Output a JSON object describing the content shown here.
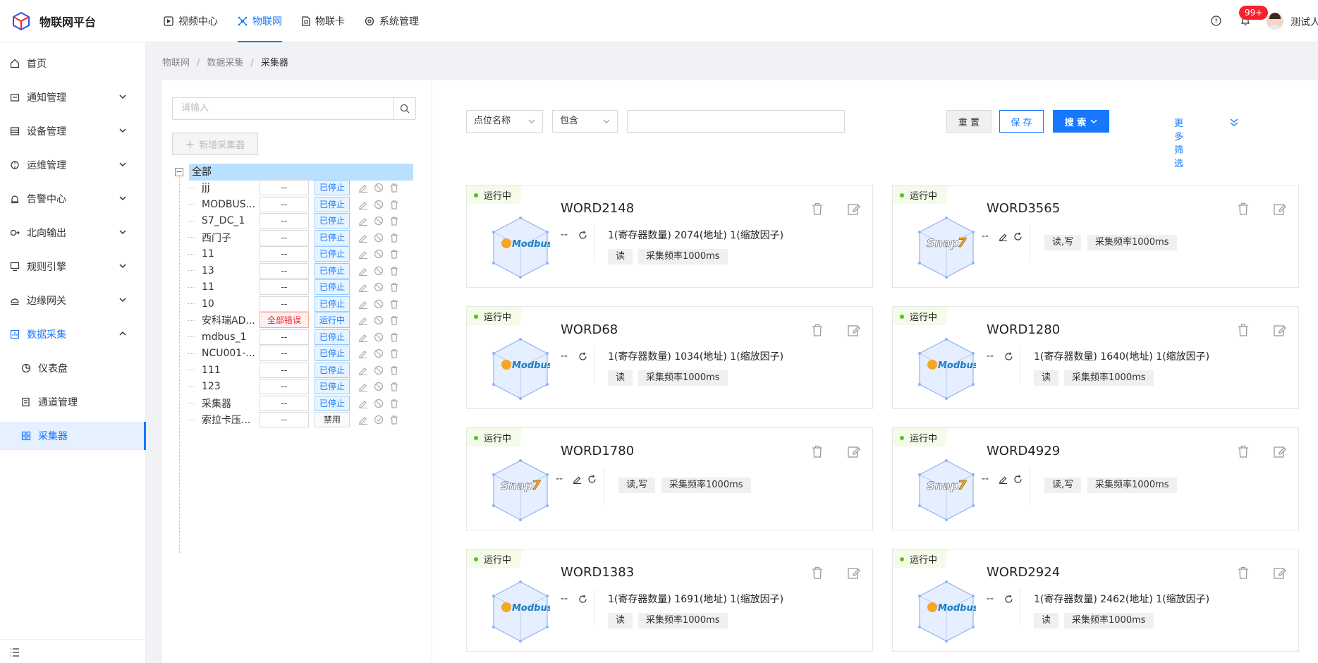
{
  "app": {
    "title": "物联网平台",
    "user": "测试人",
    "notif_count": "99+"
  },
  "topnav": [
    {
      "label": "视频中心",
      "icon": "video-icon"
    },
    {
      "label": "物联网",
      "icon": "iot-icon",
      "active": true
    },
    {
      "label": "物联卡",
      "icon": "sim-card-icon"
    },
    {
      "label": "系统管理",
      "icon": "settings-icon"
    }
  ],
  "sidebar": {
    "items": [
      {
        "label": "首页",
        "icon": "home-icon"
      },
      {
        "label": "通知管理",
        "icon": "notice-icon"
      },
      {
        "label": "设备管理",
        "icon": "device-icon"
      },
      {
        "label": "运维管理",
        "icon": "ops-icon"
      },
      {
        "label": "告警中心",
        "icon": "alarm-icon"
      },
      {
        "label": "北向输出",
        "icon": "output-icon"
      },
      {
        "label": "规则引擎",
        "icon": "rule-icon"
      },
      {
        "label": "边缘网关",
        "icon": "gateway-icon"
      },
      {
        "label": "数据采集",
        "icon": "collect-icon"
      }
    ],
    "sub_items": [
      {
        "label": "仪表盘",
        "icon": "dashboard-icon"
      },
      {
        "label": "通道管理",
        "icon": "channel-icon"
      },
      {
        "label": "采集器",
        "icon": "collector-icon"
      }
    ]
  },
  "breadcrumb": [
    "物联网",
    "数据采集",
    "采集器"
  ],
  "tree": {
    "search_placeholder": "请输入",
    "add_label": "新增采集器",
    "root_label": "全部",
    "rows": [
      {
        "name": "jjj",
        "value": "--",
        "status": "已停止"
      },
      {
        "name": "MODBUS...",
        "value": "--",
        "status": "已停止"
      },
      {
        "name": "S7_DC_1",
        "value": "--",
        "status": "已停止"
      },
      {
        "name": "西门子",
        "value": "--",
        "status": "已停止"
      },
      {
        "name": "11",
        "value": "--",
        "status": "已停止"
      },
      {
        "name": "13",
        "value": "--",
        "status": "已停止"
      },
      {
        "name": "11",
        "value": "--",
        "status": "已停止"
      },
      {
        "name": "10",
        "value": "--",
        "status": "已停止"
      },
      {
        "name": "安科瑞AD...",
        "value": "全部错误",
        "status": "运行中"
      },
      {
        "name": "mdbus_1",
        "value": "--",
        "status": "已停止"
      },
      {
        "name": "NCU001-...",
        "value": "--",
        "status": "已停止"
      },
      {
        "name": "111",
        "value": "--",
        "status": "已停止"
      },
      {
        "name": "123",
        "value": "--",
        "status": "已停止"
      },
      {
        "name": "采集器",
        "value": "--",
        "status": "已停止"
      },
      {
        "name": "索拉卡压...",
        "value": "--",
        "status": "禁用"
      }
    ]
  },
  "filter": {
    "field": "点位名称",
    "operator": "包含",
    "value": "",
    "reset": "重 置",
    "save": "保 存",
    "search": "搜 索",
    "more": "更多筛选"
  },
  "cards": [
    {
      "status": "运行中",
      "title": "WORD2148",
      "logo": "Modbus",
      "value": "--",
      "desc": "1(寄存器数量) 2074(地址) 1(缩放因子)",
      "tags": [
        "读",
        "采集频率1000ms"
      ]
    },
    {
      "status": "运行中",
      "title": "WORD3565",
      "logo": "Snap7",
      "value": "--",
      "desc": "",
      "tags": [
        "读,写",
        "采集频率1000ms"
      ]
    },
    {
      "status": "运行中",
      "title": "WORD68",
      "logo": "Modbus",
      "value": "--",
      "desc": "1(寄存器数量) 1034(地址) 1(缩放因子)",
      "tags": [
        "读",
        "采集频率1000ms"
      ]
    },
    {
      "status": "运行中",
      "title": "WORD1280",
      "logo": "Modbus",
      "value": "--",
      "desc": "1(寄存器数量) 1640(地址) 1(缩放因子)",
      "tags": [
        "读",
        "采集频率1000ms"
      ]
    },
    {
      "status": "运行中",
      "title": "WORD1780",
      "logo": "Snap7",
      "value": "--",
      "desc": "",
      "tags": [
        "读,写",
        "采集频率1000ms"
      ]
    },
    {
      "status": "运行中",
      "title": "WORD4929",
      "logo": "Snap7",
      "value": "--",
      "desc": "",
      "tags": [
        "读,写",
        "采集频率1000ms"
      ]
    },
    {
      "status": "运行中",
      "title": "WORD1383",
      "logo": "Modbus",
      "value": "--",
      "desc": "1(寄存器数量) 1691(地址) 1(缩放因子)",
      "tags": [
        "读",
        "采集频率1000ms"
      ]
    },
    {
      "status": "运行中",
      "title": "WORD2924",
      "logo": "Modbus",
      "value": "--",
      "desc": "1(寄存器数量) 2462(地址) 1(缩放因子)",
      "tags": [
        "读",
        "采集频率1000ms"
      ]
    }
  ]
}
